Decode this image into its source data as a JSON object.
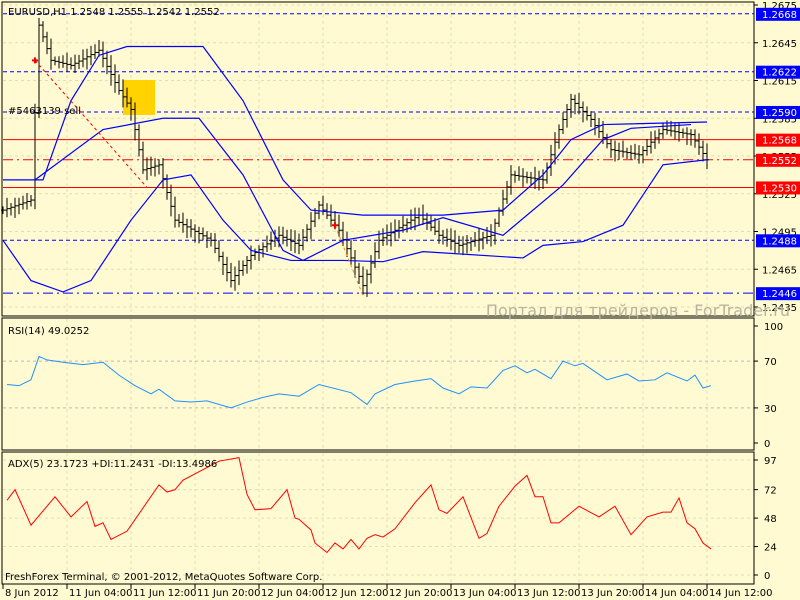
{
  "chart_data": [
    {
      "type": "ohlc",
      "title": "EURUSD,H1  1.2548 1.2555 1.2542 1.2552",
      "symbol": "EURUSD",
      "timeframe": "H1",
      "last_ohlc": {
        "open": 1.2548,
        "high": 1.2555,
        "low": 1.2542,
        "close": 1.2552
      },
      "ylim": [
        1.2435,
        1.2675
      ],
      "y_ticks": [
        "1.2675",
        "1.2645",
        "1.2615",
        "1.2585",
        "1.2555",
        "1.2525",
        "1.2495",
        "1.2465",
        "1.2435"
      ],
      "close_keypoints_bar_price": [
        [
          0,
          1.2512
        ],
        [
          7,
          1.252
        ],
        [
          9,
          1.2659
        ],
        [
          12,
          1.2631
        ],
        [
          17,
          1.2627
        ],
        [
          24,
          1.2639
        ],
        [
          29,
          1.2607
        ],
        [
          32,
          1.2592
        ],
        [
          35,
          1.2544
        ],
        [
          39,
          1.2548
        ],
        [
          43,
          1.2504
        ],
        [
          52,
          1.2488
        ],
        [
          57,
          1.2456
        ],
        [
          62,
          1.2476
        ],
        [
          69,
          1.2492
        ],
        [
          74,
          1.2484
        ],
        [
          79,
          1.2516
        ],
        [
          84,
          1.2496
        ],
        [
          90,
          1.2452
        ],
        [
          94,
          1.2488
        ],
        [
          104,
          1.2508
        ],
        [
          109,
          1.2492
        ],
        [
          114,
          1.2484
        ],
        [
          122,
          1.2492
        ],
        [
          127,
          1.254
        ],
        [
          135,
          1.2536
        ],
        [
          139,
          1.2576
        ],
        [
          142,
          1.26
        ],
        [
          147,
          1.2584
        ],
        [
          152,
          1.256
        ],
        [
          159,
          1.2556
        ],
        [
          165,
          1.2576
        ],
        [
          172,
          1.2572
        ],
        [
          176,
          1.2552
        ]
      ],
      "bollinger": {
        "upper": [
          [
            0,
            1.2536
          ],
          [
            10,
            1.2536
          ],
          [
            17,
            1.2599
          ],
          [
            24,
            1.2635
          ],
          [
            31,
            1.2642
          ],
          [
            50,
            1.2642
          ],
          [
            60,
            1.2599
          ],
          [
            70,
            1.2536
          ],
          [
            77,
            1.2512
          ],
          [
            90,
            1.2508
          ],
          [
            110,
            1.2508
          ],
          [
            125,
            1.2512
          ],
          [
            135,
            1.254
          ],
          [
            142,
            1.2568
          ],
          [
            150,
            1.258
          ],
          [
            176,
            1.2582
          ]
        ],
        "middle": [
          [
            8,
            1.2536
          ],
          [
            25,
            1.2576
          ],
          [
            40,
            1.2585
          ],
          [
            49,
            1.2585
          ],
          [
            60,
            1.254
          ],
          [
            70,
            1.248
          ],
          [
            75,
            1.2472
          ],
          [
            85,
            1.2488
          ],
          [
            100,
            1.2496
          ],
          [
            110,
            1.2506
          ],
          [
            125,
            1.2492
          ],
          [
            140,
            1.2532
          ],
          [
            150,
            1.2568
          ],
          [
            157,
            1.2577
          ],
          [
            172,
            1.258
          ]
        ],
        "lower": [
          [
            0,
            1.2488
          ],
          [
            7,
            1.2456
          ],
          [
            15,
            1.2447
          ],
          [
            22,
            1.2456
          ],
          [
            32,
            1.2504
          ],
          [
            40,
            1.2536
          ],
          [
            47,
            1.254
          ],
          [
            55,
            1.2504
          ],
          [
            62,
            1.248
          ],
          [
            72,
            1.2472
          ],
          [
            85,
            1.2472
          ],
          [
            95,
            1.2471
          ],
          [
            105,
            1.2479
          ],
          [
            130,
            1.2474
          ],
          [
            135,
            1.2484
          ],
          [
            145,
            1.2487
          ],
          [
            155,
            1.25
          ],
          [
            165,
            1.2548
          ],
          [
            176,
            1.2552
          ]
        ]
      },
      "levels": [
        {
          "price": "1.2668",
          "color": "#0000ff",
          "style": "dash"
        },
        {
          "price": "1.2622",
          "color": "#0000ff",
          "style": "dash"
        },
        {
          "price": "1.2590",
          "color": "#0000ff",
          "style": "dash"
        },
        {
          "price": "1.2568",
          "color": "#ff0000",
          "style": "solid"
        },
        {
          "price": "1.2552",
          "color": "#ff0000",
          "style": "dashdot"
        },
        {
          "price": "1.2530",
          "color": "#ff0000",
          "style": "solid"
        },
        {
          "price": "1.2488",
          "color": "#0000ff",
          "style": "dash"
        },
        {
          "price": "1.2446",
          "color": "#0000ff",
          "style": "dashdot"
        }
      ],
      "order_label": "#5463139 sell",
      "orders": [
        {
          "from": [
            8,
            1.2631
          ],
          "to": [
            36,
            1.253
          ],
          "color": "#ff0000"
        },
        {
          "from": [
            83,
            1.25
          ],
          "to": [
            90,
            1.2444
          ],
          "color": "#ff8800"
        }
      ],
      "watermark": "Портал для трейдеров - ForTrader.ru"
    },
    {
      "type": "line",
      "title": "RSI(14) 49.0252",
      "ylim": [
        0,
        100
      ],
      "y_ticks": [
        "100",
        "70",
        "30",
        "0"
      ],
      "levels": [
        70,
        30
      ],
      "color": "#1e90ff",
      "points_bar_value": [
        [
          1,
          50
        ],
        [
          4,
          49
        ],
        [
          7,
          54
        ],
        [
          9,
          74
        ],
        [
          11,
          71
        ],
        [
          15,
          69
        ],
        [
          20,
          67
        ],
        [
          25,
          69
        ],
        [
          29,
          58
        ],
        [
          33,
          49
        ],
        [
          37,
          42
        ],
        [
          39,
          46
        ],
        [
          43,
          36
        ],
        [
          47,
          35
        ],
        [
          51,
          36
        ],
        [
          57,
          30
        ],
        [
          61,
          35
        ],
        [
          65,
          39
        ],
        [
          69,
          42
        ],
        [
          74,
          40
        ],
        [
          79,
          50
        ],
        [
          87,
          43
        ],
        [
          91,
          33
        ],
        [
          93,
          42
        ],
        [
          98,
          50
        ],
        [
          103,
          53
        ],
        [
          107,
          55
        ],
        [
          110,
          47
        ],
        [
          114,
          42
        ],
        [
          117,
          48
        ],
        [
          121,
          47
        ],
        [
          125,
          62
        ],
        [
          128,
          66
        ],
        [
          131,
          60
        ],
        [
          133,
          63
        ],
        [
          137,
          55
        ],
        [
          140,
          70
        ],
        [
          143,
          66
        ],
        [
          145,
          68
        ],
        [
          151,
          54
        ],
        [
          156,
          59
        ],
        [
          159,
          53
        ],
        [
          163,
          54
        ],
        [
          166,
          60
        ],
        [
          171,
          53
        ],
        [
          173,
          58
        ],
        [
          175,
          47
        ],
        [
          177,
          49
        ]
      ]
    },
    {
      "type": "line",
      "title": "ADX(5) 23.1723 +DI:11.2431 -DI:13.4986",
      "ylim": [
        0,
        97
      ],
      "y_ticks": [
        "97",
        "72",
        "48",
        "24",
        "0"
      ],
      "color": "#ff0000",
      "points_bar_value": [
        [
          1,
          63
        ],
        [
          3,
          72
        ],
        [
          7,
          42
        ],
        [
          13,
          66
        ],
        [
          17,
          49
        ],
        [
          21,
          62
        ],
        [
          23,
          41
        ],
        [
          25,
          44
        ],
        [
          27,
          30
        ],
        [
          31,
          37
        ],
        [
          39,
          76
        ],
        [
          41,
          70
        ],
        [
          43,
          72
        ],
        [
          45,
          80
        ],
        [
          54,
          96
        ],
        [
          59,
          99
        ],
        [
          61,
          68
        ],
        [
          63,
          55
        ],
        [
          67,
          56
        ],
        [
          71,
          72
        ],
        [
          73,
          48
        ],
        [
          74,
          47
        ],
        [
          77,
          38
        ],
        [
          78,
          27
        ],
        [
          81,
          19
        ],
        [
          83,
          27
        ],
        [
          85,
          22
        ],
        [
          87,
          30
        ],
        [
          89,
          22
        ],
        [
          91,
          31
        ],
        [
          93,
          34
        ],
        [
          95,
          32
        ],
        [
          98,
          39
        ],
        [
          103,
          61
        ],
        [
          107,
          76
        ],
        [
          109,
          55
        ],
        [
          111,
          52
        ],
        [
          115,
          66
        ],
        [
          119,
          31
        ],
        [
          121,
          35
        ],
        [
          124,
          58
        ],
        [
          128,
          75
        ],
        [
          131,
          84
        ],
        [
          133,
          66
        ],
        [
          135,
          66
        ],
        [
          137,
          44
        ],
        [
          139,
          44
        ],
        [
          144,
          58
        ],
        [
          149,
          49
        ],
        [
          153,
          58
        ],
        [
          157,
          34
        ],
        [
          161,
          49
        ],
        [
          165,
          53
        ],
        [
          167,
          53
        ],
        [
          169,
          65
        ],
        [
          171,
          44
        ],
        [
          173,
          39
        ],
        [
          175,
          27
        ],
        [
          177,
          22
        ]
      ]
    }
  ],
  "time_axis": [
    "8 Jun 2012",
    "11 Jun 04:00",
    "11 Jun 12:00",
    "11 Jun 20:00",
    "12 Jun 04:00",
    "12 Jun 12:00",
    "12 Jun 20:00",
    "13 Jun 04:00",
    "13 Jun 12:00",
    "13 Jun 20:00",
    "14 Jun 04:00",
    "14 Jun 12:00"
  ],
  "copyright": "FreshForex Terminal, © 2001-2012, MetaQuotes Software Corp."
}
